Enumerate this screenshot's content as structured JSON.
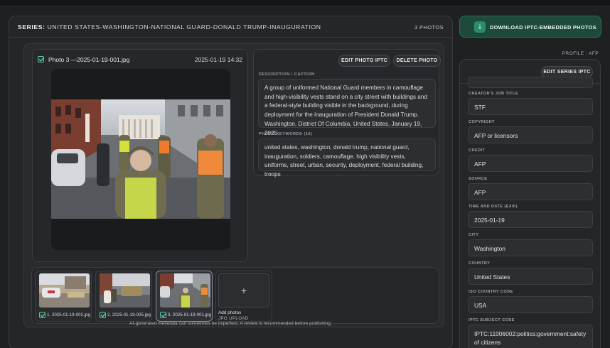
{
  "series": {
    "prefix": "SERIES:",
    "title": "UNITED STATES-WASHINGTON-NATIONAL GUARD-DONALD TRUMP-INAUGURATION",
    "count": "3 PHOTOS"
  },
  "photo": {
    "name": "Photo 3 —2025-01-19-001.jpg",
    "datetime": "2025-01-19 14:32",
    "edit_label": "EDIT PHOTO IPTC",
    "delete_label": "DELETE PHOTO",
    "caption_label": "DESCRIPTION / CAPTION",
    "caption": "A group of uniformed National Guard members in camouflage and high-visibility vests stand on a city street with buildings and a federal-style building visible in the background, during deployment for the inauguration of President Donald Trump. Washington, District Of Columbia, United States, January 19, 2025.",
    "keywords_label": "PHOTO KEYWORDS (15)",
    "keywords": "united states, washington, donald trump, national guard, inauguration, soldiers, camouflage, high visibility vests, uniforms, street, urban, security, deployment, federal building, troops"
  },
  "thumbnails": [
    {
      "label": "1. 2025-01-19-002.jpg",
      "checked": true,
      "active": false
    },
    {
      "label": "2. 2025-01-19-005.jpg",
      "checked": true,
      "active": false
    },
    {
      "label": "3. 2025-01-19-001.jpg",
      "checked": true,
      "active": true
    }
  ],
  "add_photo": {
    "icon": "+",
    "label": "Add photos",
    "sub": "JPG UPLOAD"
  },
  "footer_note": "AI-generated metadata can sometimes be imperfect. A review is recommended before publishing.",
  "download": {
    "icon": "download-icon",
    "label": "DOWNLOAD IPTC-EMBEDDED PHOTOS"
  },
  "profile": "PROFILE : AFP",
  "side": {
    "edit_label": "EDIT SERIES IPTC",
    "fields": [
      {
        "label": "CREATOR'S JOB TITLE",
        "value": "STF"
      },
      {
        "label": "COPYRIGHT",
        "value": "AFP or licensors"
      },
      {
        "label": "CREDIT",
        "value": "AFP"
      },
      {
        "label": "SOURCE",
        "value": "AFP"
      },
      {
        "label": "TIME AND DATE (EXIF)",
        "value": "2025-01-19"
      },
      {
        "label": "CITY",
        "value": "Washington"
      },
      {
        "label": "COUNTRY",
        "value": "United States"
      },
      {
        "label": "ISO COUNTRY CODE",
        "value": "USA"
      },
      {
        "label": "IPTC SUBJECT CODE",
        "value": "IPTC:11006002:politics:government:safety of citizens"
      }
    ]
  },
  "colors": {
    "accent": "#2a8d68",
    "check": "#8ee2c2",
    "background": "#1f2022"
  }
}
